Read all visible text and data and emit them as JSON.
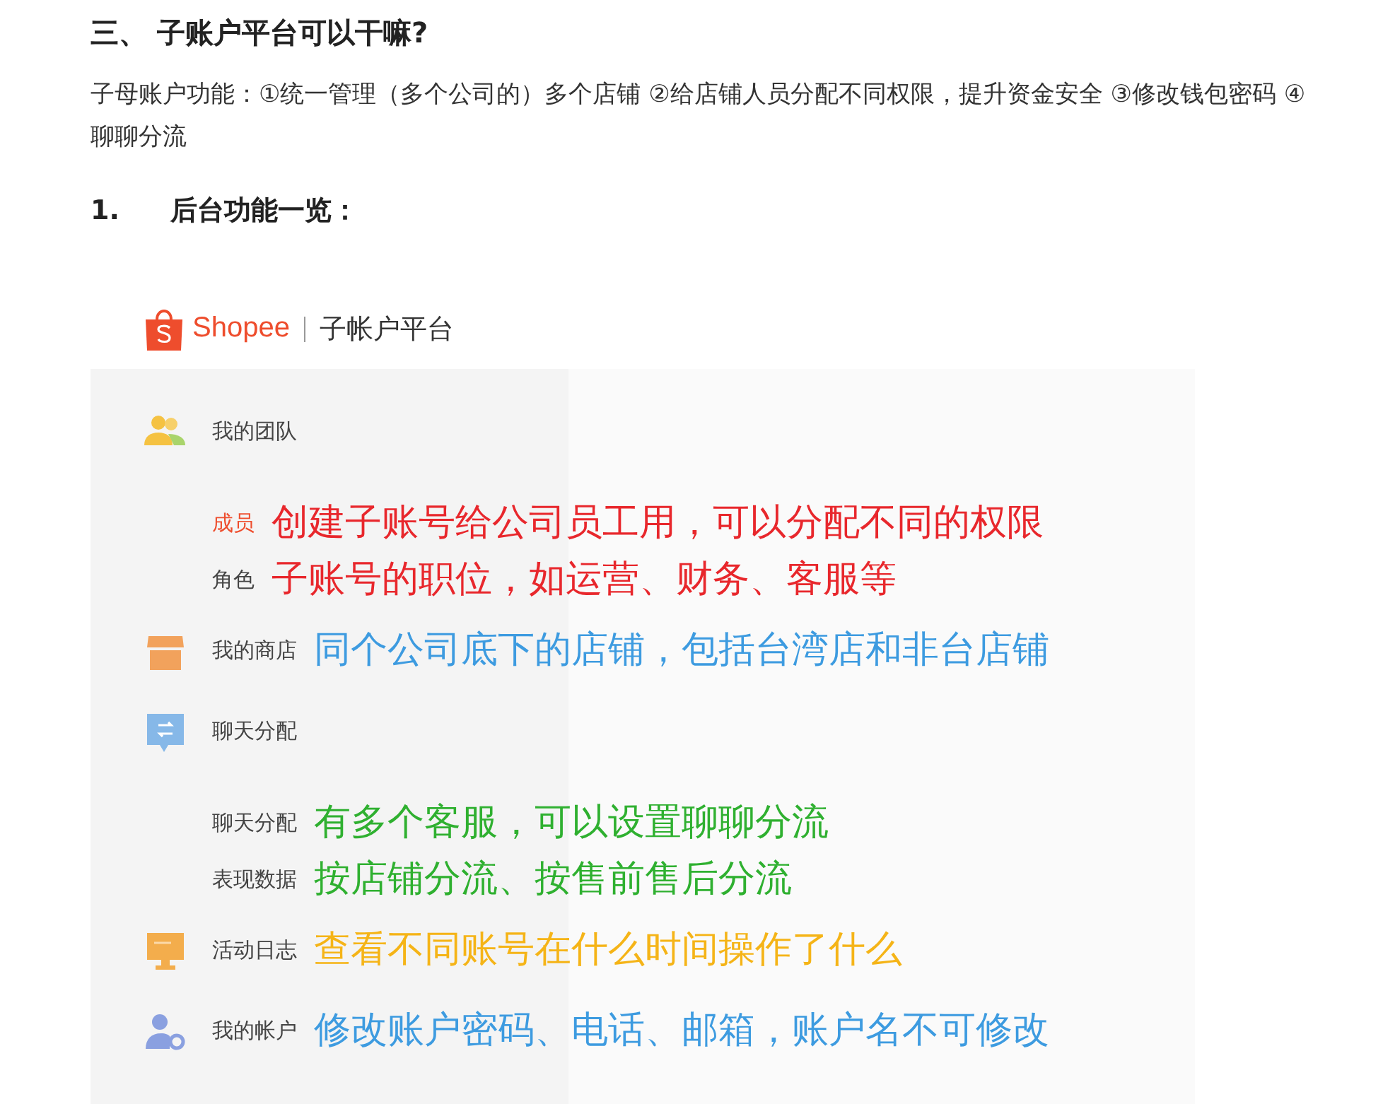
{
  "heading": "三、 子账户平台可以干嘛?",
  "intro": "子母账户功能：①统一管理（多个公司的）多个店铺 ②给店铺人员分配不同权限，提升资金安全 ③修改钱包密码 ④聊聊分流",
  "subheading": {
    "number": "1.",
    "title": "后台功能一览："
  },
  "screenshot": {
    "brand": "Shopee",
    "platform": "子帐户平台",
    "menu": [
      {
        "kind": "group",
        "label": "我的团队"
      },
      {
        "kind": "sub",
        "label": "成员",
        "selected": true,
        "note": "创建子账号给公司员工用，可以分配不同的权限",
        "color": "#e8272c"
      },
      {
        "kind": "sub",
        "label": "角色",
        "selected": false,
        "note": "子账号的职位，如运营、财务、客服等",
        "color": "#e8272c"
      },
      {
        "kind": "group",
        "label": "我的商店",
        "note": "同个公司底下的店铺，包括台湾店和非台店铺",
        "color": "#3d9be0"
      },
      {
        "kind": "group",
        "label": "聊天分配"
      },
      {
        "kind": "sub",
        "label": "聊天分配",
        "selected": false,
        "note": "有多个客服，可以设置聊聊分流",
        "color": "#2fb030"
      },
      {
        "kind": "sub",
        "label": "表现数据",
        "selected": false,
        "note": "按店铺分流、按售前售后分流",
        "color": "#2fb030"
      },
      {
        "kind": "group",
        "label": "活动日志",
        "note": "查看不同账号在什么时间操作了什么",
        "color": "#f5b417"
      },
      {
        "kind": "group",
        "label": "我的帐户",
        "note": "修改账户密码、电话、邮箱，账户名不可修改",
        "color": "#3d9be0"
      }
    ]
  }
}
